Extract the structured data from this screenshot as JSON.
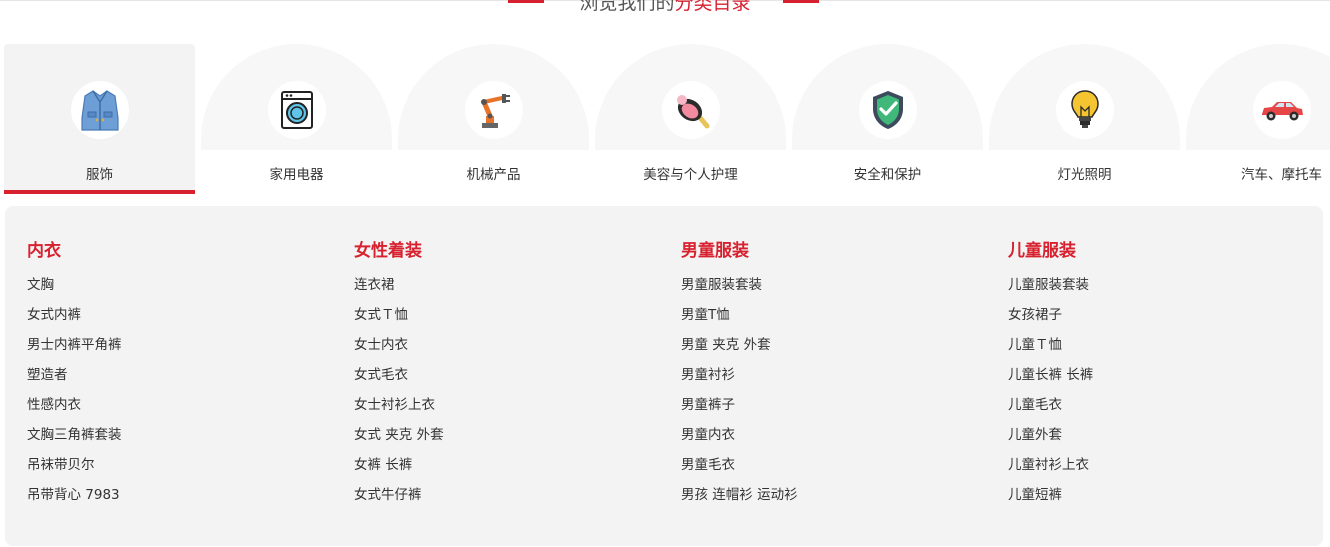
{
  "section_heading": {
    "prefix": "浏览我们的",
    "highlight": "分类目录"
  },
  "colors": {
    "accent": "#d8212f"
  },
  "categories": [
    {
      "label": "服饰",
      "icon": "jacket-icon",
      "active": true
    },
    {
      "label": "家用电器",
      "icon": "washing-machine-icon",
      "active": false
    },
    {
      "label": "机械产品",
      "icon": "robot-arm-icon",
      "active": false
    },
    {
      "label": "美容与个人护理",
      "icon": "makeup-compact-icon",
      "active": false
    },
    {
      "label": "安全和保护",
      "icon": "shield-check-icon",
      "active": false
    },
    {
      "label": "灯光照明",
      "icon": "light-bulb-icon",
      "active": false
    },
    {
      "label": "汽车、摩托车",
      "icon": "car-icon",
      "active": false
    }
  ],
  "subcategories": [
    {
      "title": "内衣",
      "items": [
        "文胸",
        "女式内裤",
        "男士内裤平角裤",
        "塑造者",
        "性感内衣",
        "文胸三角裤套装",
        "吊袜带贝尔",
        "吊带背心 7983"
      ]
    },
    {
      "title": "女性着装",
      "items": [
        "连衣裙",
        "女式Ｔ恤",
        "女士内衣",
        "女式毛衣",
        "女士衬衫上衣",
        "女式 夹克 外套",
        "女裤 长裤",
        "女式牛仔裤"
      ]
    },
    {
      "title": "男童服装",
      "items": [
        "男童服装套装",
        "男童T恤",
        "男童 夹克 外套",
        "男童衬衫",
        "男童裤子",
        "男童内衣",
        "男童毛衣",
        "男孩 连帽衫 运动衫"
      ]
    },
    {
      "title": "儿童服装",
      "items": [
        "儿童服装套装",
        "女孩裙子",
        "儿童Ｔ恤",
        "儿童长裤 长裤",
        "儿童毛衣",
        "儿童外套",
        "儿童衬衫上衣",
        "儿童短裤"
      ]
    }
  ]
}
